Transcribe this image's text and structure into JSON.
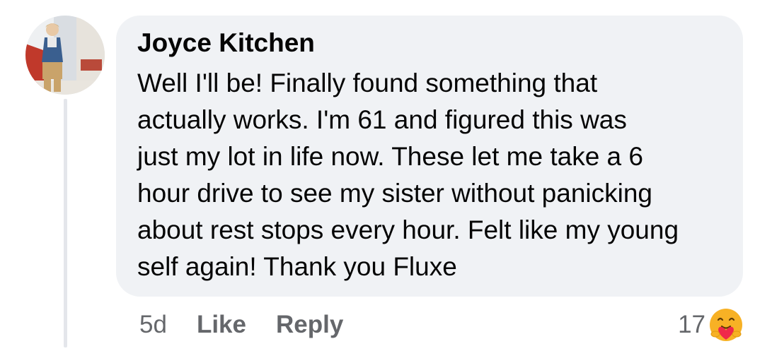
{
  "comment": {
    "author": "Joyce Kitchen",
    "text": "Well I'll be! Finally found something that\nactually works. I'm 61 and figured this was\njust my lot in life now. These let me take a 6\nhour drive to see my sister without panicking\nabout rest stops every hour. Felt like my young\nself again! Thank you Fluxe",
    "avatar_icon": "profile-photo"
  },
  "actions": {
    "time": "5d",
    "like_label": "Like",
    "reply_label": "Reply"
  },
  "reactions": {
    "count": "17",
    "icon": "care-reaction-icon"
  },
  "colors": {
    "bubble": "#f0f2f5",
    "text": "#050505",
    "secondary": "#65676b",
    "thread_line": "#e4e6eb"
  }
}
